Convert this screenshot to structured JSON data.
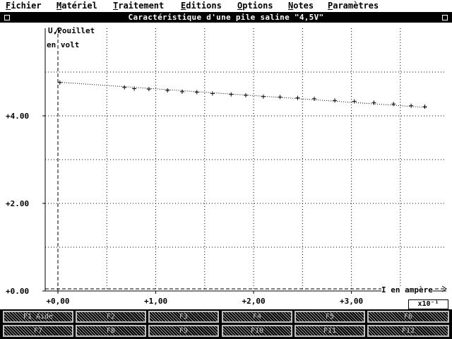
{
  "menu": [
    {
      "hot": "F",
      "rest": "ichier"
    },
    {
      "hot": "M",
      "rest": "atériel"
    },
    {
      "hot": "T",
      "rest": "raitement"
    },
    {
      "hot": "E",
      "rest": "ditions"
    },
    {
      "hot": "O",
      "rest": "ptions"
    },
    {
      "hot": "N",
      "rest": "otes"
    },
    {
      "hot": "P",
      "rest": "aramètres"
    }
  ],
  "window": {
    "title": "Caractéristique d'une pile saline \"4,5V\""
  },
  "chart_data": {
    "type": "scatter",
    "title": "Caractéristique d'une pile saline \"4,5V\"",
    "ylabel_1": "U,Pouillet",
    "ylabel_2": "en volt",
    "xlabel": "I en ampère",
    "x_multiplier": "x10⁻¹",
    "y_ticks": [
      "+0.00",
      "+2.00",
      "+4.00"
    ],
    "x_ticks": [
      "+0,00",
      "+1,00",
      "+2,00",
      "+3,00"
    ],
    "xlim": [
      -0.13,
      3.97
    ],
    "ylim": [
      0,
      6.0
    ],
    "grid": true,
    "x": [
      0.02,
      0.68,
      0.78,
      0.93,
      1.12,
      1.27,
      1.42,
      1.58,
      1.77,
      1.92,
      2.1,
      2.27,
      2.45,
      2.62,
      2.83,
      3.03,
      3.23,
      3.43,
      3.61,
      3.75
    ],
    "y": [
      4.76,
      4.65,
      4.62,
      4.61,
      4.58,
      4.55,
      4.54,
      4.51,
      4.49,
      4.47,
      4.44,
      4.43,
      4.41,
      4.39,
      4.35,
      4.33,
      4.3,
      4.27,
      4.23,
      4.21
    ],
    "fit_line": {
      "x": [
        0.0,
        3.77
      ],
      "y": [
        4.77,
        4.19
      ]
    }
  },
  "buttons": [
    {
      "label": "F1 Aide"
    },
    {
      "label": "F2"
    },
    {
      "label": "F3"
    },
    {
      "label": "F4"
    },
    {
      "label": "F5"
    },
    {
      "label": "F6"
    },
    {
      "label": "F7"
    },
    {
      "label": "F8"
    },
    {
      "label": "F9"
    },
    {
      "label": "F10"
    },
    {
      "label": "F11"
    },
    {
      "label": "F12"
    }
  ]
}
